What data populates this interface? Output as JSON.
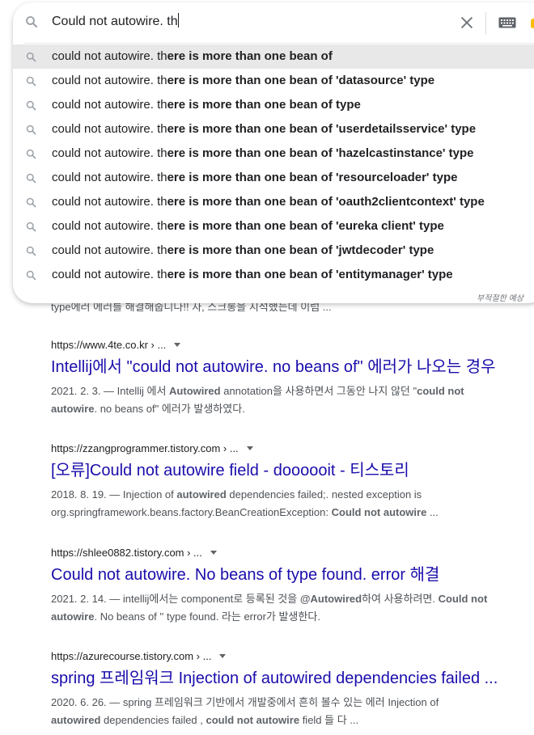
{
  "search": {
    "query": "Could not autowire. th",
    "icon": "search-icon",
    "clear_icon": "close-icon",
    "keyboard_icon": "keyboard-icon"
  },
  "suggestions": [
    {
      "prefix": "could not autowire. th",
      "completion": "ere is more than one bean of"
    },
    {
      "prefix": "could not autowire. th",
      "completion": "ere is more than one bean of 'datasource' type"
    },
    {
      "prefix": "could not autowire. th",
      "completion": "ere is more than one bean of type"
    },
    {
      "prefix": "could not autowire. th",
      "completion": "ere is more than one bean of 'userdetailsservice' type"
    },
    {
      "prefix": "could not autowire. th",
      "completion": "ere is more than one bean of 'hazelcastinstance' type"
    },
    {
      "prefix": "could not autowire. th",
      "completion": "ere is more than one bean of 'resourceloader' type"
    },
    {
      "prefix": "could not autowire. th",
      "completion": "ere is more than one bean of 'oauth2clientcontext' type"
    },
    {
      "prefix": "could not autowire. th",
      "completion": "ere is more than one bean of 'eureka client' type"
    },
    {
      "prefix": "could not autowire. th",
      "completion": "ere is more than one bean of 'jwtdecoder' type"
    },
    {
      "prefix": "could not autowire. th",
      "completion": "ere is more than one bean of 'entitymanager' type"
    }
  ],
  "report_label": "부적절한 예상",
  "clipped_snippet": "type에러 에러를 해결해줍니다!! 자, 스크롱을 지석했는데 이럼 ...",
  "results": [
    {
      "cite": "https://www.4te.co.kr › ...",
      "title": "Intellij에서 \"could not autowire. no beans of\" 에러가 나오는 경우",
      "line1": [
        {
          "t": "2021. 2. 3. — Intellij 에서 ",
          "b": false
        },
        {
          "t": "Autowired",
          "b": true
        },
        {
          "t": " annotation을 사용하면서 그동안 나지 않던 \"",
          "b": false
        },
        {
          "t": "could not",
          "b": true
        }
      ],
      "line2": [
        {
          "t": "autowire",
          "b": true
        },
        {
          "t": ". no beans of\" 에러가 발생하였다.",
          "b": false
        }
      ]
    },
    {
      "cite": "https://zzangprogrammer.tistory.com › ...",
      "title": "[오류]Could not autowire field - doooooit - 티스토리",
      "line1": [
        {
          "t": "2018. 8. 19. — Injection of ",
          "b": false
        },
        {
          "t": "autowired",
          "b": true
        },
        {
          "t": " dependencies failed;. nested exception is",
          "b": false
        }
      ],
      "line2": [
        {
          "t": "org.springframework.beans.factory.BeanCreationException: ",
          "b": false
        },
        {
          "t": "Could not autowire",
          "b": true
        },
        {
          "t": " ...",
          "b": false
        }
      ]
    },
    {
      "cite": "https://shlee0882.tistory.com › ...",
      "title": "Could not autowire. No beans of type found. error 해결",
      "line1": [
        {
          "t": "2021. 2. 14. — intellij에서는 component로 등록된 것을 ",
          "b": false
        },
        {
          "t": "@Autowired",
          "b": true
        },
        {
          "t": "하여 사용하려면. ",
          "b": false
        },
        {
          "t": "Could not",
          "b": true
        }
      ],
      "line2": [
        {
          "t": "autowire",
          "b": true
        },
        {
          "t": ". No beans of '' type found. 라는 error가 발생한다.",
          "b": false
        }
      ]
    },
    {
      "cite": "https://azurecourse.tistory.com › ...",
      "title": "spring 프레임워크 Injection of autowired dependencies failed ...",
      "line1": [
        {
          "t": "2020. 6. 26. — spring 프레임워크 기반에서 개발중에서 흔히 볼수 있는 에러 Injection of",
          "b": false
        }
      ],
      "line2": [
        {
          "t": "autowired",
          "b": true
        },
        {
          "t": " dependencies failed , ",
          "b": false
        },
        {
          "t": "could not autowire",
          "b": true
        },
        {
          "t": " field 들 다 ...",
          "b": false
        }
      ]
    }
  ]
}
